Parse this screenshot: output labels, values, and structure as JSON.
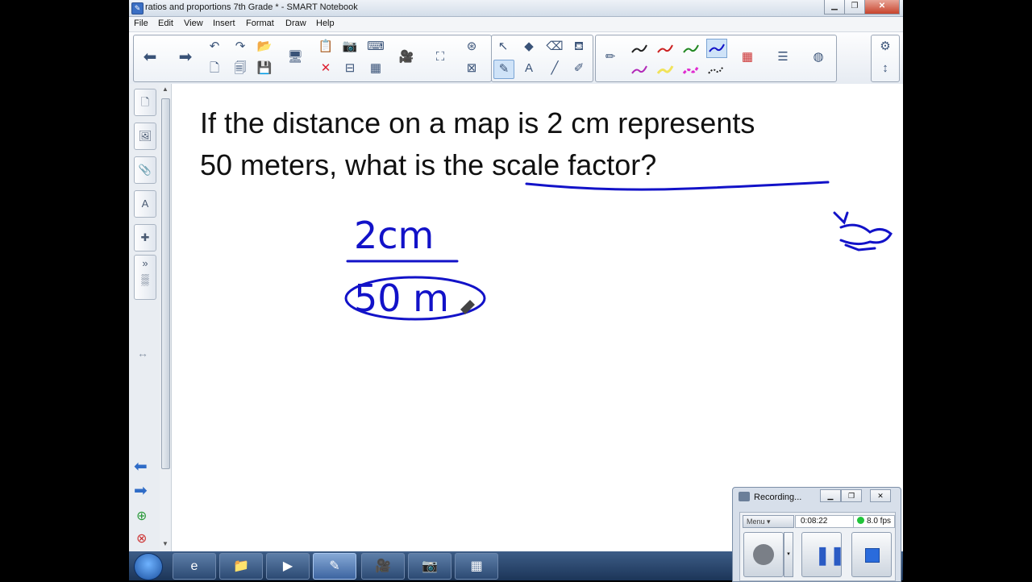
{
  "window": {
    "title": "ratios and proportions 7th Grade * - SMART Notebook"
  },
  "menu": [
    "File",
    "Edit",
    "View",
    "Insert",
    "Format",
    "Draw",
    "Help"
  ],
  "page": {
    "line1": "If the distance on a map is 2 cm represents",
    "line2": "50 meters, what is the scale factor?"
  },
  "ink": {
    "numerator": "2cm",
    "denominator": "50 m"
  },
  "recorder": {
    "title": "Recording...",
    "menu_label": "Menu",
    "elapsed": "0:08:22",
    "fps": "8.0 fps"
  },
  "colors": {
    "ink": "#1212c8",
    "accent": "#3a6fc4"
  },
  "icons": {
    "back": "arrow-left-icon",
    "forward": "arrow-right-icon",
    "undo": "undo-icon",
    "redo": "redo-icon",
    "select": "pointer-icon",
    "pen": "pen-icon",
    "eraser": "eraser-icon",
    "properties": "gear-icon"
  }
}
